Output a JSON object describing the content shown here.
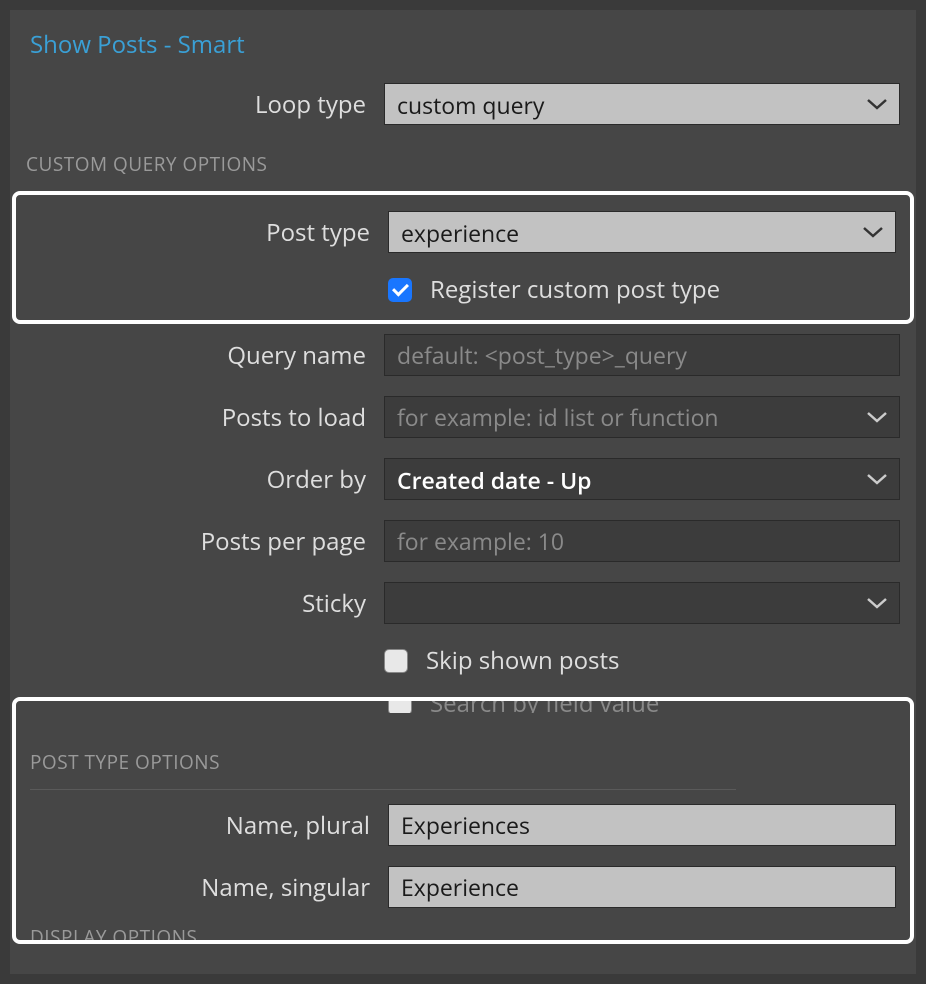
{
  "panel": {
    "title": "Show Posts - Smart"
  },
  "loopType": {
    "label": "Loop type",
    "value": "custom query"
  },
  "sections": {
    "customQuery": "CUSTOM QUERY OPTIONS",
    "postTypeOptions": "POST TYPE OPTIONS",
    "displayOptions": "DISPLAY OPTIONS"
  },
  "postType": {
    "label": "Post type",
    "value": "experience"
  },
  "registerCpt": {
    "label": "Register custom post type",
    "checked": true
  },
  "queryName": {
    "label": "Query name",
    "value": "",
    "placeholder": "default: <post_type>_query"
  },
  "postsToLoad": {
    "label": "Posts to load",
    "value": "",
    "placeholder": "for example: id list or function"
  },
  "orderBy": {
    "label": "Order by",
    "value": "Created date - Up"
  },
  "postsPerPage": {
    "label": "Posts per page",
    "value": "",
    "placeholder": "for example: 10"
  },
  "sticky": {
    "label": "Sticky",
    "value": ""
  },
  "skipShown": {
    "label": "Skip shown posts",
    "checked": false
  },
  "searchByField": {
    "label": "Search by field value",
    "checked": false
  },
  "namePlural": {
    "label": "Name, plural",
    "value": "Experiences"
  },
  "nameSingular": {
    "label": "Name, singular",
    "value": "Experience"
  }
}
